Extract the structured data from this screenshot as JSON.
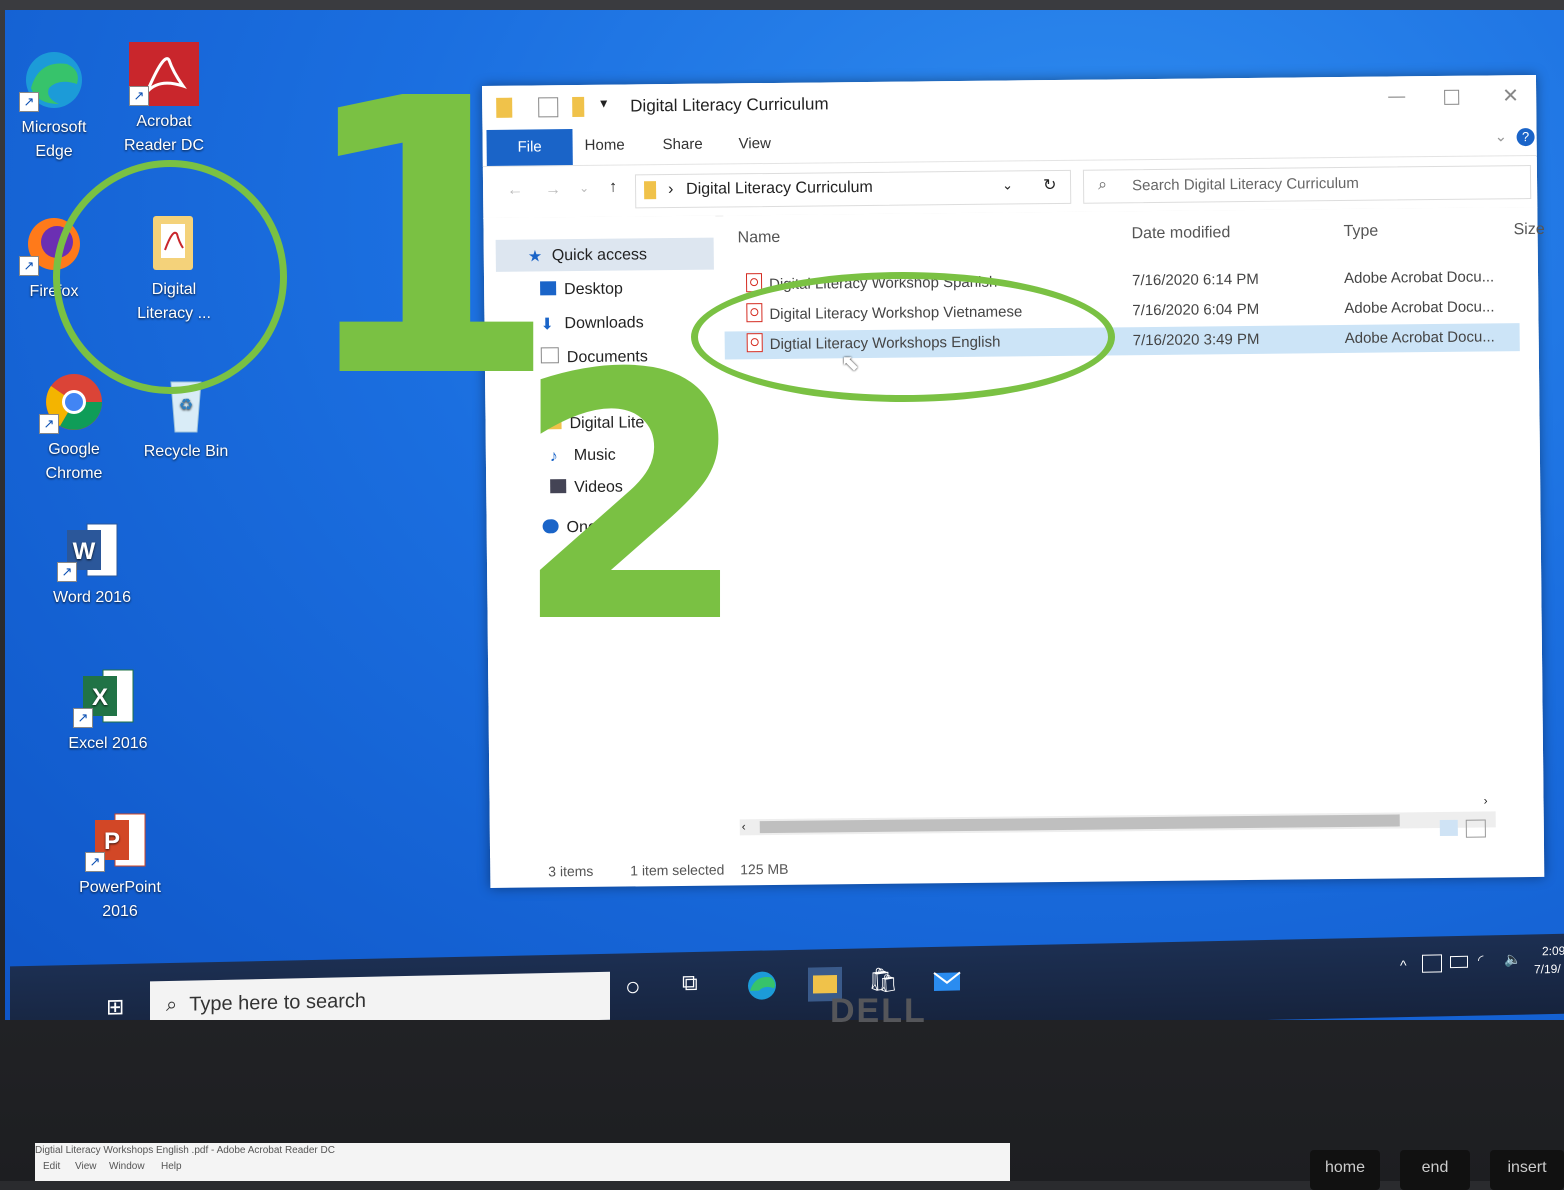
{
  "desktop": {
    "icons": [
      {
        "label": "Microsoft\nEdge",
        "name": "microsoft-edge"
      },
      {
        "label": "Acrobat\nReader DC",
        "name": "acrobat-reader"
      },
      {
        "label": "Firefox",
        "name": "firefox"
      },
      {
        "label": "Digital\nLiteracy ...",
        "name": "digital-literacy-folder"
      },
      {
        "label": "Google\nChrome",
        "name": "google-chrome"
      },
      {
        "label": "Recycle Bin",
        "name": "recycle-bin"
      },
      {
        "label": "Word 2016",
        "name": "word-2016"
      },
      {
        "label": "Excel 2016",
        "name": "excel-2016"
      },
      {
        "label": "PowerPoint\n2016",
        "name": "powerpoint-2016"
      }
    ]
  },
  "annotations": {
    "step1": "1",
    "step2": "2"
  },
  "window": {
    "title": "Digital Literacy Curriculum",
    "ribbon_tabs": [
      "File",
      "Home",
      "Share",
      "View"
    ],
    "address": "Digital Literacy Curriculum",
    "search_placeholder": "Search Digital Literacy Curriculum",
    "nav": [
      "Quick access",
      "Desktop",
      "Downloads",
      "Documents",
      "Digital Lite",
      "Music",
      "Videos",
      "OneDrive"
    ],
    "columns": [
      "Name",
      "Date modified",
      "Type",
      "Size"
    ],
    "files": [
      {
        "name": "Digital Literacy Workshop Spanish",
        "date": "7/16/2020 6:14 PM",
        "type": "Adobe Acrobat Docu..."
      },
      {
        "name": "Digital Literacy Workshop Vietnamese",
        "date": "7/16/2020 6:04 PM",
        "type": "Adobe Acrobat Docu..."
      },
      {
        "name": "Digtial Literacy Workshops English",
        "date": "7/16/2020 3:49 PM",
        "type": "Adobe Acrobat Docu..."
      }
    ],
    "status": {
      "items": "3 items",
      "selected": "1 item selected",
      "size": "125 MB"
    }
  },
  "taskbar": {
    "search_placeholder": "Type here to search",
    "time": "2:09",
    "date": "7/19/"
  },
  "brand": "DELL",
  "acrobat_strip": {
    "title": "Digtial Literacy Workshops English .pdf - Adobe Acrobat Reader DC",
    "menu": [
      "Edit",
      "View",
      "Window",
      "Help"
    ]
  },
  "keys": [
    "home",
    "end",
    "insert"
  ]
}
